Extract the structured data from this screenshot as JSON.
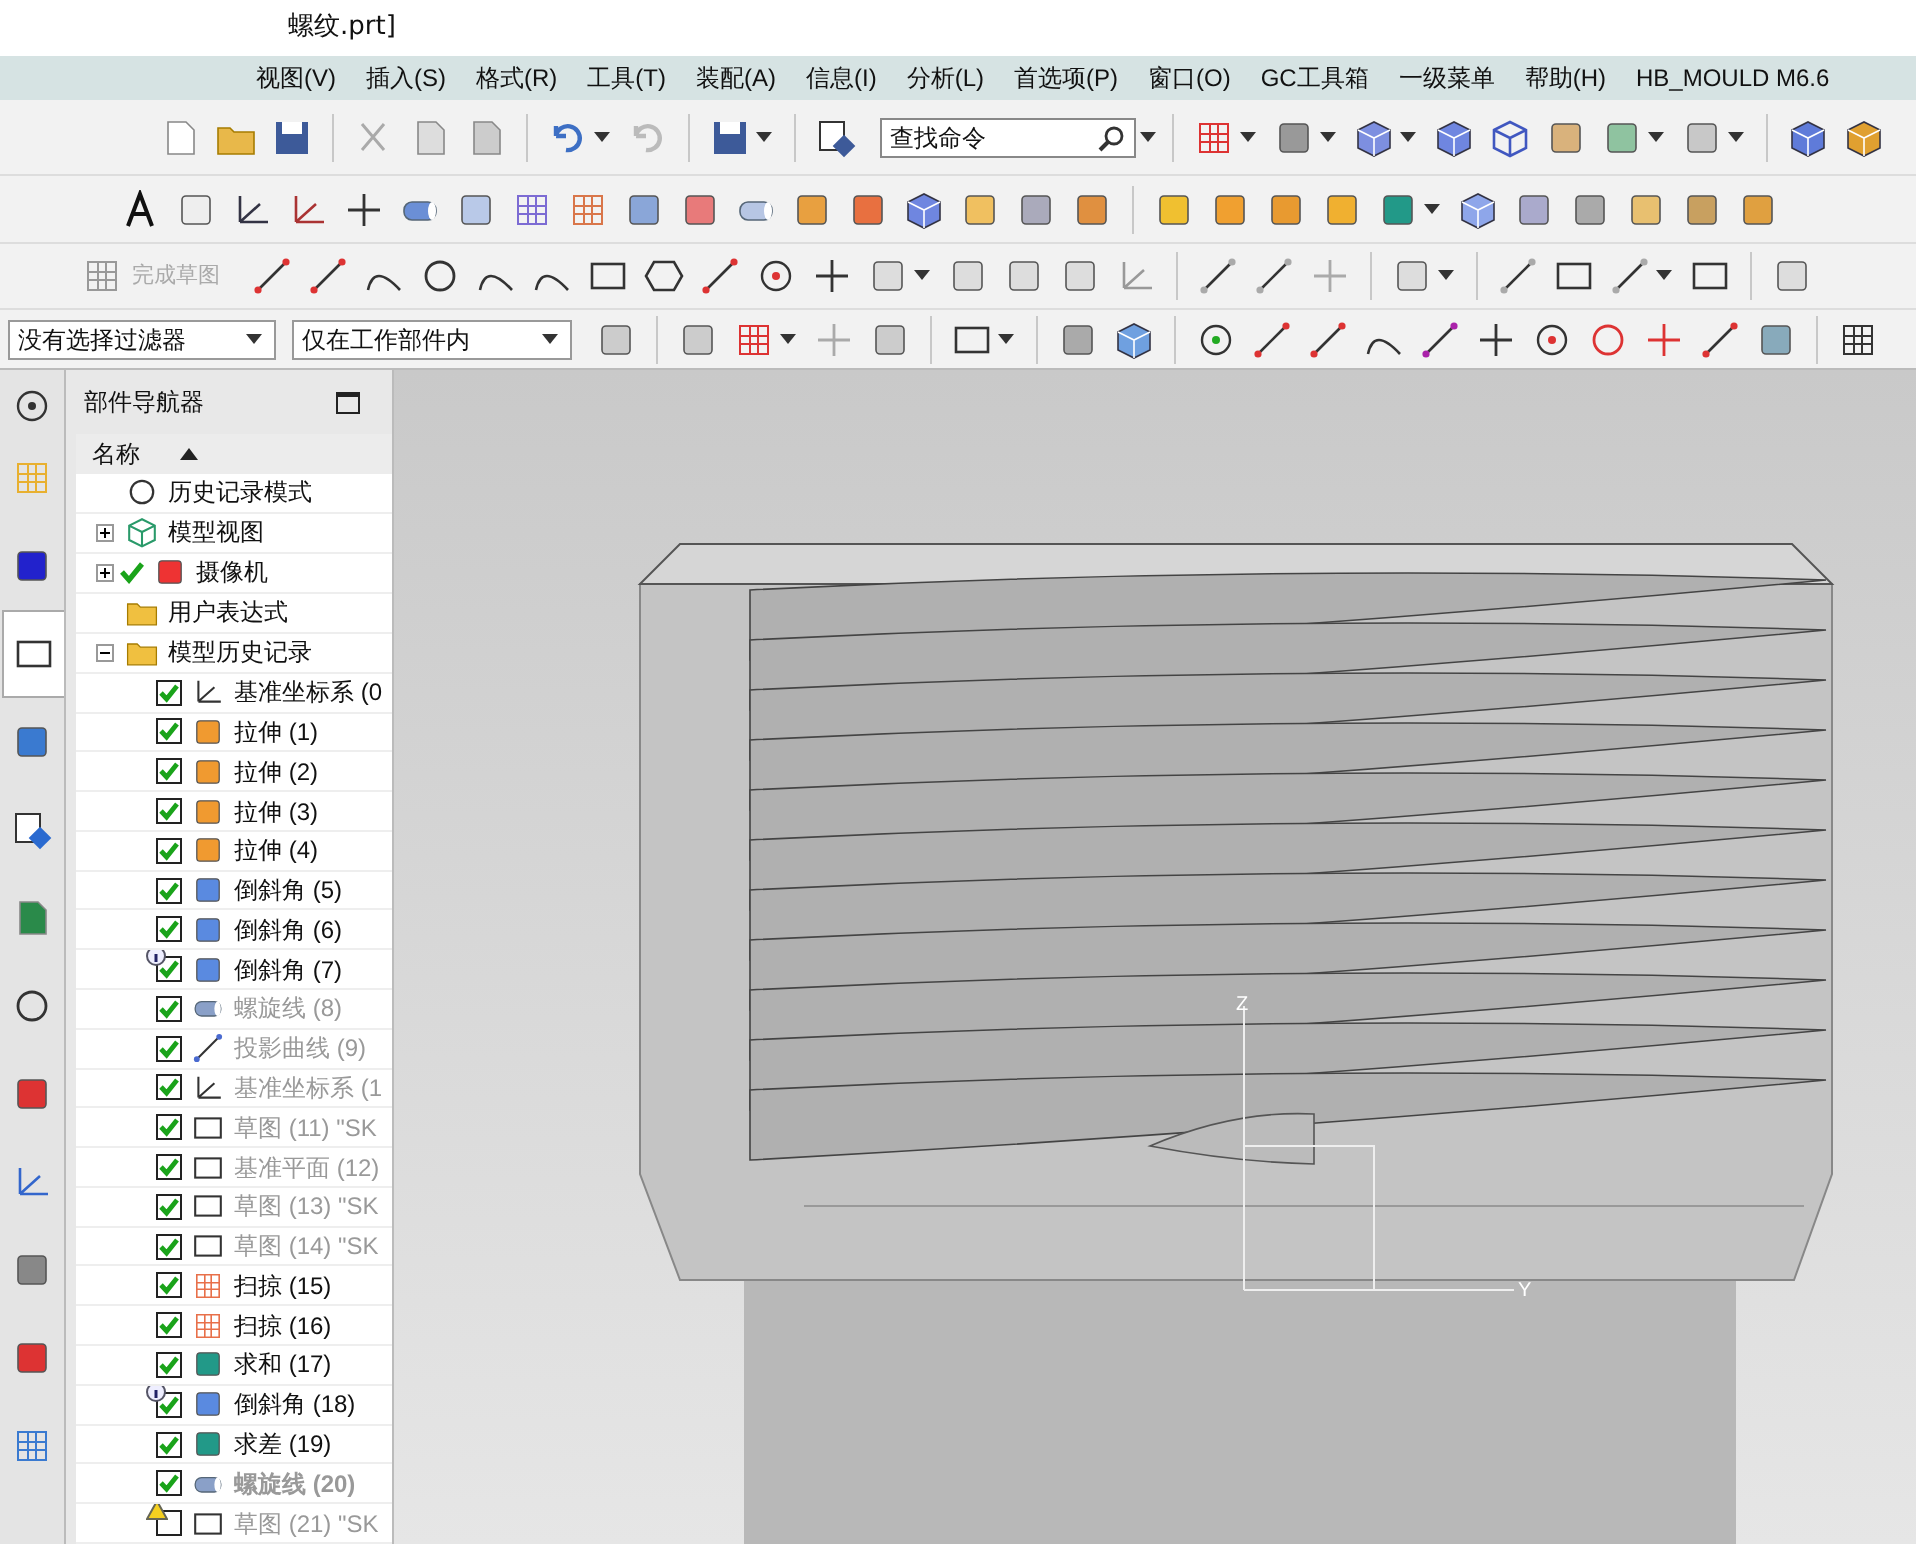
{
  "window": {
    "title": "螺纹.prt]"
  },
  "menu": [
    "视图(V)",
    "插入(S)",
    "格式(R)",
    "工具(T)",
    "装配(A)",
    "信息(I)",
    "分析(L)",
    "首选项(P)",
    "窗口(O)",
    "GC工具箱",
    "一级菜单",
    "帮助(H)",
    "HB_MOULD M6.6"
  ],
  "toolbar": {
    "search": {
      "value": "查找命令"
    },
    "finish_sketch": {
      "label": "完成草图",
      "disabled": true
    },
    "filters": [
      {
        "value": "没有选择过滤器"
      },
      {
        "value": "仅在工作部件内"
      }
    ]
  },
  "resource_bar": [
    {
      "selected": false
    },
    {
      "selected": false
    },
    {
      "selected": false
    },
    {
      "selected": true
    },
    {
      "selected": false
    },
    {
      "selected": false
    },
    {
      "selected": false
    },
    {
      "selected": false
    },
    {
      "selected": false
    },
    {
      "selected": false
    },
    {
      "selected": false
    },
    {
      "selected": false
    },
    {
      "selected": false
    }
  ],
  "navigator": {
    "title": "部件导航器",
    "column": "名称",
    "nodes": [
      {
        "label": "历史记录模式",
        "kind": "clock",
        "checked": false
      },
      {
        "label": "模型视图",
        "kind": "view",
        "checked": false,
        "expanded": false
      },
      {
        "label": "摄像机",
        "kind": "camera",
        "checked": true,
        "expanded": false
      },
      {
        "label": "用户表达式",
        "kind": "expression",
        "checked": false
      },
      {
        "label": "模型历史记录",
        "kind": "folder",
        "checked": false,
        "expanded": true,
        "children": [
          {
            "label": "基准坐标系 (0",
            "kind": "csys",
            "checked": true,
            "dimmed": false,
            "bold": false,
            "info": false,
            "warning": false
          },
          {
            "label": "拉伸 (1)",
            "kind": "extrude",
            "checked": true,
            "dimmed": false,
            "bold": false,
            "info": false,
            "warning": false
          },
          {
            "label": "拉伸 (2)",
            "kind": "extrude",
            "checked": true,
            "dimmed": false,
            "bold": false,
            "info": false,
            "warning": false
          },
          {
            "label": "拉伸 (3)",
            "kind": "extrude",
            "checked": true,
            "dimmed": false,
            "bold": false,
            "info": false,
            "warning": false
          },
          {
            "label": "拉伸 (4)",
            "kind": "extrude",
            "checked": true,
            "dimmed": false,
            "bold": false,
            "info": false,
            "warning": false
          },
          {
            "label": "倒斜角 (5)",
            "kind": "chamfer",
            "checked": true,
            "dimmed": false,
            "bold": false,
            "info": false,
            "warning": false
          },
          {
            "label": "倒斜角 (6)",
            "kind": "chamfer",
            "checked": true,
            "dimmed": false,
            "bold": false,
            "info": false,
            "warning": false
          },
          {
            "label": "倒斜角 (7)",
            "kind": "chamfer",
            "checked": true,
            "dimmed": false,
            "bold": false,
            "info": true,
            "warning": false
          },
          {
            "label": "螺旋线 (8)",
            "kind": "helix",
            "checked": true,
            "dimmed": true,
            "bold": false,
            "info": false,
            "warning": false
          },
          {
            "label": "投影曲线 (9)",
            "kind": "project",
            "checked": true,
            "dimmed": true,
            "bold": false,
            "info": false,
            "warning": false
          },
          {
            "label": "基准坐标系 (1",
            "kind": "csys",
            "checked": true,
            "dimmed": true,
            "bold": false,
            "info": false,
            "warning": false
          },
          {
            "label": "草图 (11) \"SK",
            "kind": "sketch",
            "checked": true,
            "dimmed": true,
            "bold": false,
            "info": false,
            "warning": false
          },
          {
            "label": "基准平面 (12)",
            "kind": "plane",
            "checked": true,
            "dimmed": true,
            "bold": false,
            "info": false,
            "warning": false
          },
          {
            "label": "草图 (13) \"SK",
            "kind": "sketch",
            "checked": true,
            "dimmed": true,
            "bold": false,
            "info": false,
            "warning": false
          },
          {
            "label": "草图 (14) \"SK",
            "kind": "sketch",
            "checked": true,
            "dimmed": true,
            "bold": false,
            "info": false,
            "warning": false
          },
          {
            "label": "扫掠 (15)",
            "kind": "sweep",
            "checked": true,
            "dimmed": false,
            "bold": false,
            "info": false,
            "warning": false
          },
          {
            "label": "扫掠 (16)",
            "kind": "sweep",
            "checked": true,
            "dimmed": false,
            "bold": false,
            "info": false,
            "warning": false
          },
          {
            "label": "求和 (17)",
            "kind": "unite",
            "checked": true,
            "dimmed": false,
            "bold": false,
            "info": false,
            "warning": false
          },
          {
            "label": "倒斜角 (18)",
            "kind": "chamfer",
            "checked": true,
            "dimmed": false,
            "bold": false,
            "info": true,
            "warning": false
          },
          {
            "label": "求差 (19)",
            "kind": "subtract",
            "checked": true,
            "dimmed": false,
            "bold": false,
            "info": false,
            "warning": false
          },
          {
            "label": "螺旋线 (20)",
            "kind": "helix",
            "checked": true,
            "dimmed": true,
            "bold": true,
            "info": false,
            "warning": false
          },
          {
            "label": "草图 (21) \"SK",
            "kind": "sketch",
            "checked": false,
            "dimmed": true,
            "bold": false,
            "info": false,
            "warning": true
          }
        ]
      }
    ]
  },
  "viewport": {
    "triad": {
      "z": "Z",
      "y": "Y"
    }
  }
}
